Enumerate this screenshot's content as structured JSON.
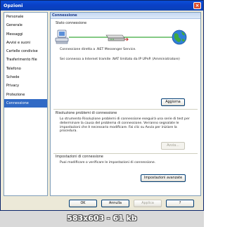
{
  "window": {
    "title": "Opzioni",
    "close_label": "×"
  },
  "sidebar": {
    "items": [
      {
        "label": "Personale"
      },
      {
        "label": "Generale"
      },
      {
        "label": "Messaggi"
      },
      {
        "label": "Avvisi e suoni"
      },
      {
        "label": "Cartelle condivise"
      },
      {
        "label": "Trasferimento file"
      },
      {
        "label": "Telefono"
      },
      {
        "label": "Schede"
      },
      {
        "label": "Privacy"
      },
      {
        "label": "Protezione"
      },
      {
        "label": "Connessione"
      }
    ],
    "selected": "Connessione"
  },
  "panel": {
    "header": "Connessione",
    "status_section": {
      "title": "Stato connessione",
      "direct_text": "Connessione diretta a .NET Messenger Service.",
      "nat_text": "Sei connesso a Internet tramite .NAT limitato da IP UPnP. (Amministratore)",
      "refresh_button": "Aggiorna"
    },
    "troubleshoot_section": {
      "title": "Risoluzione problemi di connessione",
      "description": "Lo strumento Risoluzione problemi di connessione eseguirà una serie di test per determinare la causa del problema di connessione. Verranno segnalate le impostazioni che è necessario modificare. Fai clic su Avvia per iniziare la procedura.",
      "start_button": "Avvia..."
    },
    "settings_section": {
      "title": "Impostazioni di connessione",
      "description": "Puoi modificare o verificare le impostazioni di connessione.",
      "advanced_button": "Impostazioni avanzate"
    }
  },
  "buttons": {
    "ok": "OK",
    "cancel": "Annulla",
    "apply": "Applica",
    "help": "?"
  },
  "footer": {
    "caption": "583x603 - 61 kb"
  },
  "icons": [
    "computer-icon",
    "router-icon",
    "globe-icon"
  ],
  "colors": {
    "title_bar": "#0a3fc4",
    "selection": "#316ac5",
    "link_line": "#3aaa3a",
    "footer_bg": "#d9d9d9"
  }
}
